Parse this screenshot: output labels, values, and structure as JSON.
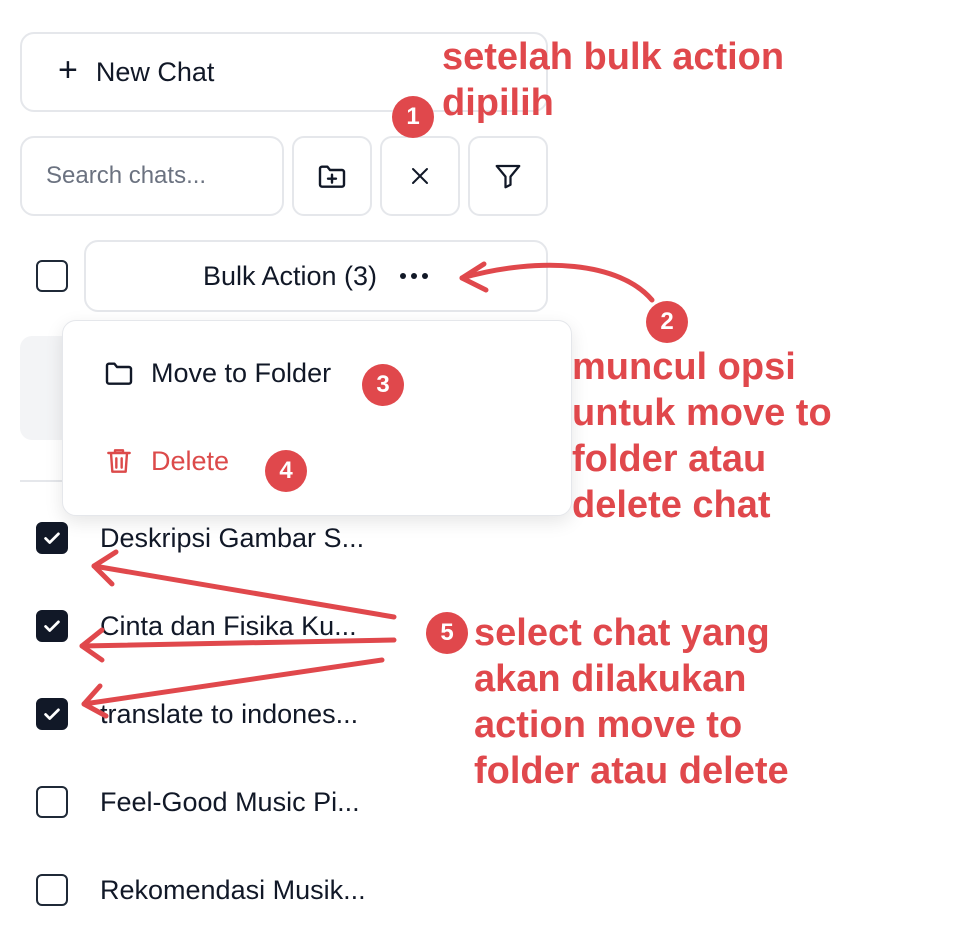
{
  "sidebar": {
    "new_chat_label": "New Chat",
    "search_placeholder": "Search chats...",
    "bulk_action_label": "Bulk Action (3)",
    "menu": {
      "move_label": "Move to Folder",
      "delete_label": "Delete"
    },
    "chats": [
      {
        "title": "Deskripsi Gambar S...",
        "checked": true
      },
      {
        "title": "Cinta dan Fisika Ku...",
        "checked": true
      },
      {
        "title": "translate to indones...",
        "checked": true
      },
      {
        "title": "Feel-Good Music Pi...",
        "checked": false
      },
      {
        "title": "Rekomendasi Musik...",
        "checked": false
      }
    ]
  },
  "annotations": {
    "note1_line1": "setelah bulk action",
    "note1_line2": "dipilih",
    "note2_line1": "muncul opsi",
    "note2_line2": "untuk move to",
    "note2_line3": "folder atau",
    "note2_line4": "delete chat",
    "note5_line1": "select chat yang",
    "note5_line2": "akan dilakukan",
    "note5_line3": "action move to",
    "note5_line4": "folder atau delete",
    "badges": [
      "1",
      "2",
      "3",
      "4",
      "5"
    ]
  },
  "colors": {
    "annotation": "#e0484c",
    "delete": "#dc4a4a",
    "checkbox_checked": "#111827",
    "border": "#e5e7eb"
  }
}
